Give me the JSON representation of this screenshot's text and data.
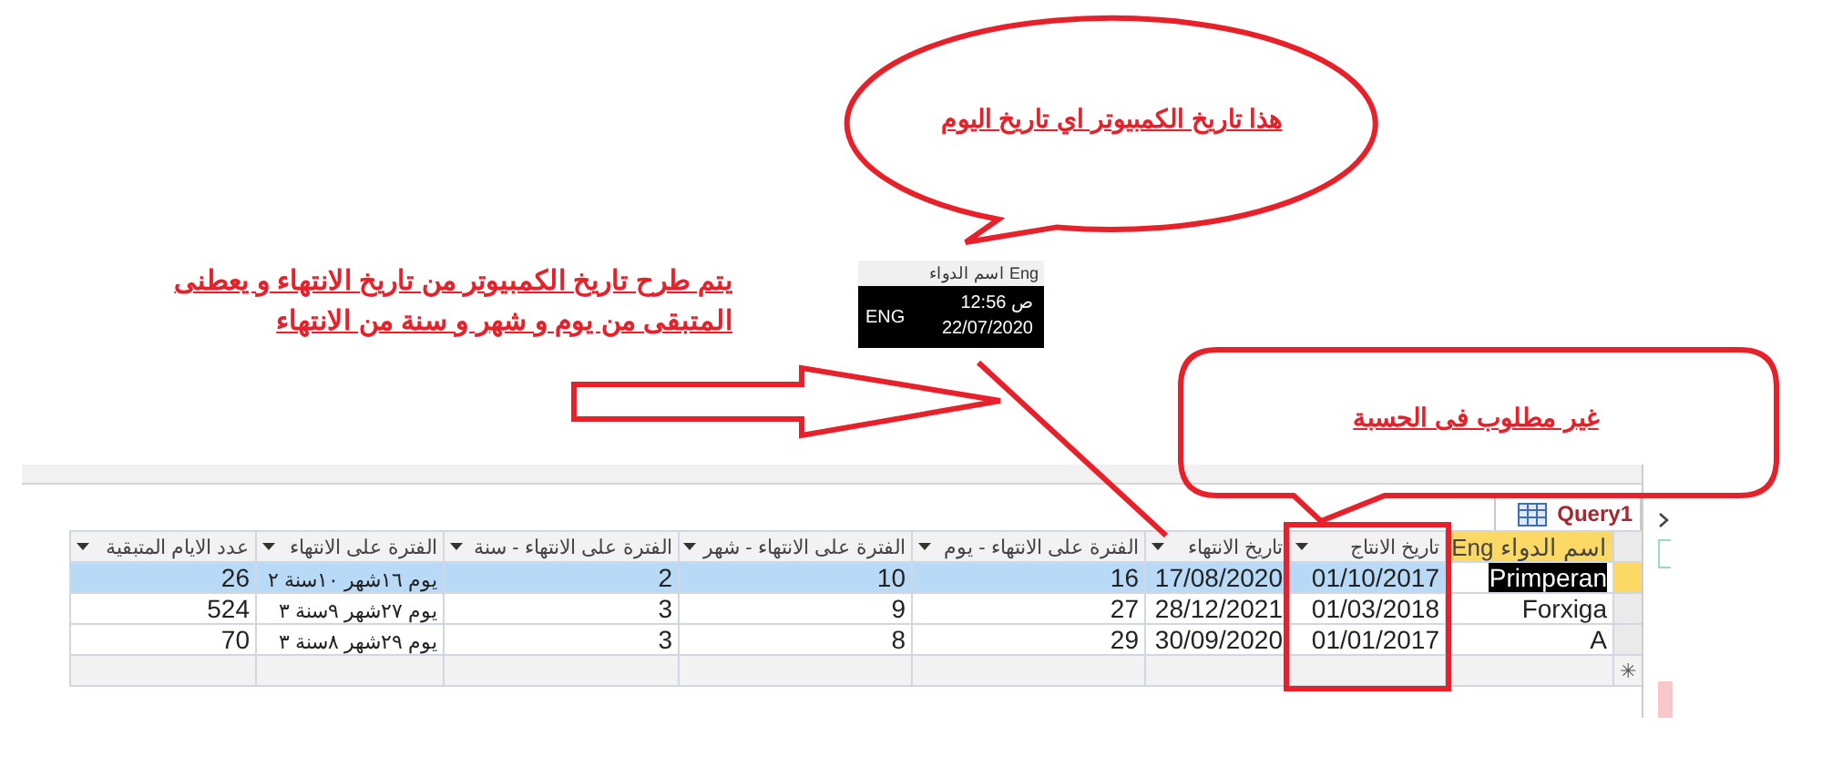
{
  "notes": {
    "lines": [
      "يتم طرح تاريخ الكمبيوتر من تاريخ الانتهاء و يعطنى",
      "المتبقى من يوم و شهر و سنة من الانتهاء"
    ]
  },
  "callouts": [
    {
      "kind": "ellipse",
      "text": "هذا تاريخ الكمبيوتر اي تاريخ اليوم"
    },
    {
      "kind": "box",
      "text": "غير مطلوب فى الحسبة"
    }
  ],
  "clock": {
    "tooltip": "اسم الدواء Eng",
    "language": "ENG",
    "time": "12:56 ص",
    "date": "22/07/2020"
  },
  "tab": {
    "label": "Query1"
  },
  "table": {
    "columns": [
      {
        "label": "اسم الدواء Eng",
        "selected": true
      },
      {
        "label": "تاريخ الانتاج",
        "selected": false
      },
      {
        "label": "تاريخ الانتهاء",
        "selected": false
      },
      {
        "label": "الفترة على الانتهاء - يوم",
        "selected": false
      },
      {
        "label": "الفترة على الانتهاء - شهر",
        "selected": false
      },
      {
        "label": "الفترة على الانتهاء - سنة",
        "selected": false
      },
      {
        "label": "الفترة على الانتهاء",
        "selected": false
      },
      {
        "label": "عدد الايام المتبقية",
        "selected": false
      }
    ],
    "rows": [
      {
        "selected": true,
        "cells": [
          "Primperan",
          "01/10/2017",
          "17/08/2020",
          "16",
          "10",
          "2",
          "يوم ١٦شهر ١٠سنة ٢",
          "26"
        ]
      },
      {
        "selected": false,
        "cells": [
          "Forxiga",
          "01/03/2018",
          "28/12/2021",
          "27",
          "9",
          "3",
          "يوم ٢٧شهر ٩سنة ٣",
          "524"
        ]
      },
      {
        "selected": false,
        "cells": [
          "A",
          "01/01/2017",
          "30/09/2020",
          "29",
          "8",
          "3",
          "يوم ٢٩شهر ٨سنة ٣",
          "70"
        ]
      }
    ],
    "new_row_marker": "✳"
  }
}
